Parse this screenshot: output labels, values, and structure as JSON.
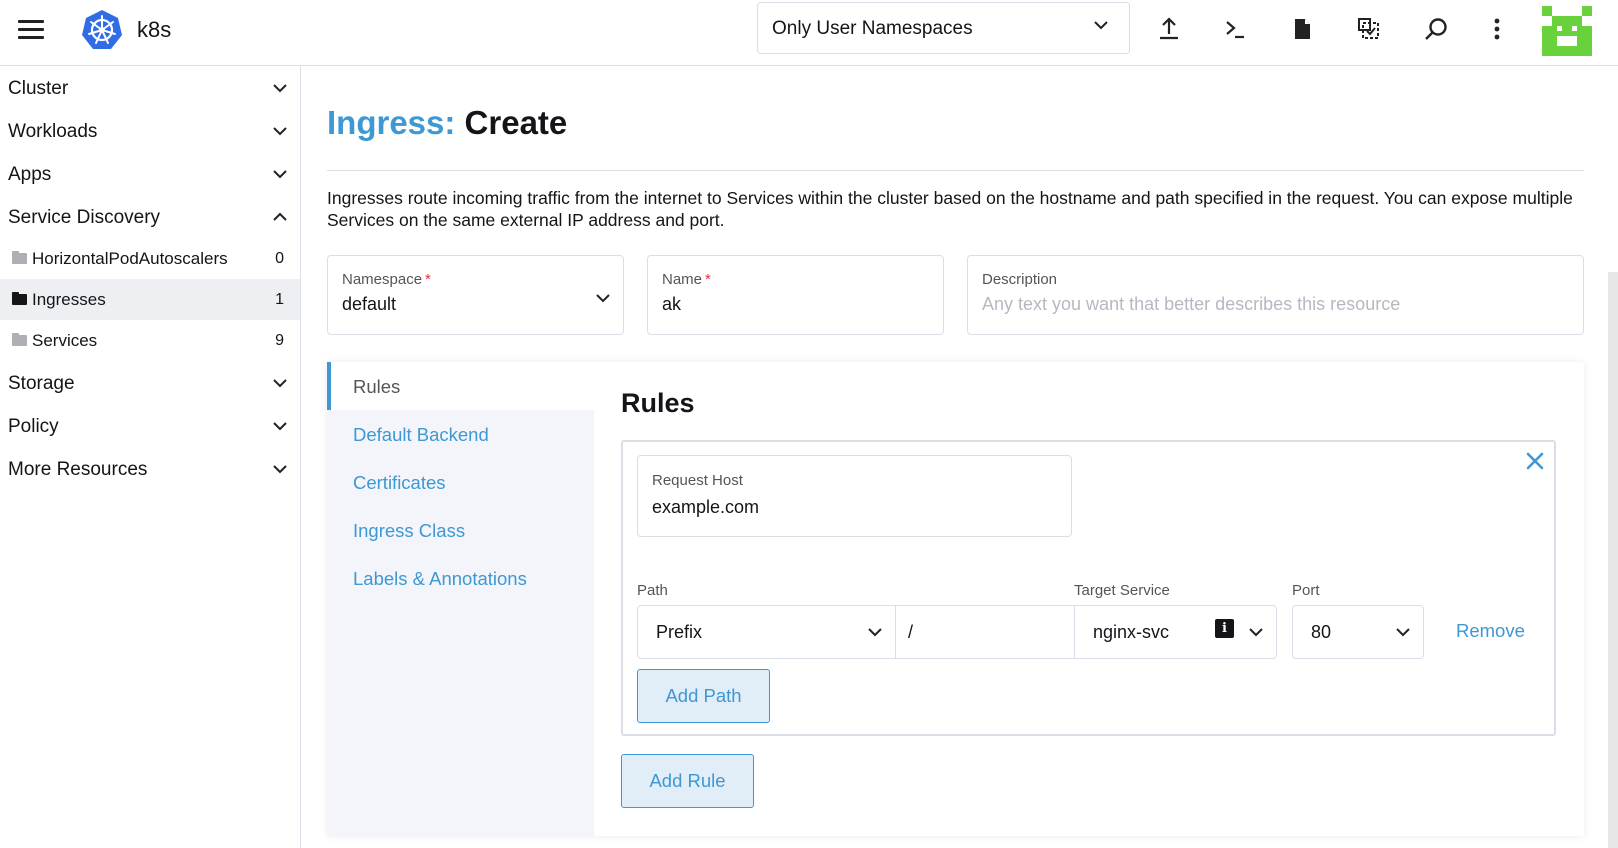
{
  "header": {
    "cluster_name": "k8s",
    "namespace_filter": "Only User Namespaces",
    "icons": [
      "menu-icon",
      "kubernetes-logo-icon",
      "upload-icon",
      "terminal-icon",
      "file-icon",
      "copy-config-icon",
      "search-icon",
      "more-vertical-icon",
      "user-avatar-icon"
    ]
  },
  "sidebar": {
    "groups": {
      "cluster": "Cluster",
      "workloads": "Workloads",
      "apps": "Apps",
      "service_discovery": "Service Discovery",
      "storage": "Storage",
      "policy": "Policy",
      "more_resources": "More Resources"
    },
    "items": [
      {
        "label": "HorizontalPodAutoscalers",
        "count": "0"
      },
      {
        "label": "Ingresses",
        "count": "1"
      },
      {
        "label": "Services",
        "count": "9"
      }
    ]
  },
  "page": {
    "title_resource": "Ingress:",
    "title_action": "Create",
    "description": "Ingresses route incoming traffic from the internet to Services within the cluster based on the hostname and path specified in the request. You can expose multiple Services on the same external IP address and port."
  },
  "form": {
    "namespace_label": "Namespace",
    "namespace_value": "default",
    "name_label": "Name",
    "name_value": "ak",
    "required_marker": "*",
    "description_label": "Description",
    "description_placeholder": "Any text you want that better describes this resource"
  },
  "tabs": [
    "Rules",
    "Default Backend",
    "Certificates",
    "Ingress Class",
    "Labels & Annotations"
  ],
  "rules": {
    "heading": "Rules",
    "request_host_label": "Request Host",
    "request_host_value": "example.com",
    "path_label": "Path",
    "path_type": "Prefix",
    "path_value": "/",
    "target_service_label": "Target Service",
    "target_service_value": "nginx-svc",
    "port_label": "Port",
    "port_value": "80",
    "remove_label": "Remove",
    "add_path_label": "Add Path",
    "add_rule_label": "Add Rule"
  },
  "colors": {
    "accent": "#3d98d3",
    "required": "#e0313c",
    "border": "#dcdee7",
    "tab_bg": "#f4f5fa",
    "k8s_blue": "#326ce5",
    "avatar_green": "#69d13c",
    "folder_grey": "#aeaeb4"
  }
}
